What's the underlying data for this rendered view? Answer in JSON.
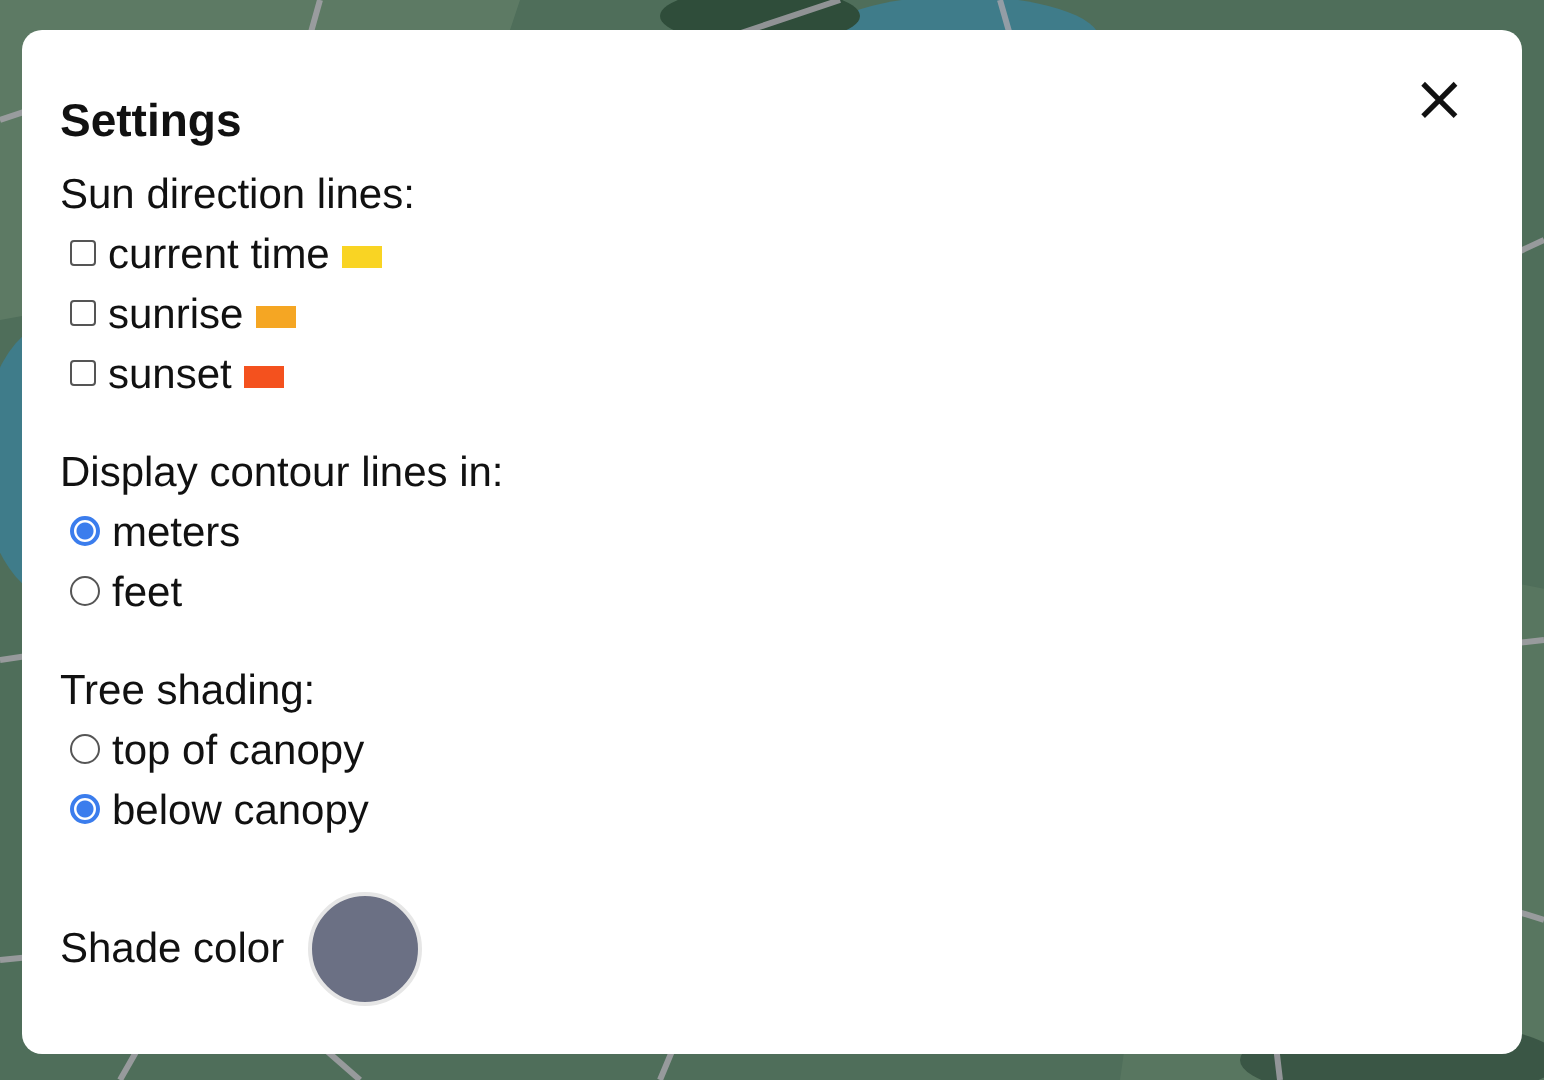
{
  "dialog": {
    "title": "Settings",
    "close": "×"
  },
  "sun_lines": {
    "label": "Sun direction lines:",
    "options": [
      {
        "label": "current time",
        "checked": false,
        "color": "#f9d423"
      },
      {
        "label": "sunrise",
        "checked": false,
        "color": "#f5a623"
      },
      {
        "label": "sunset",
        "checked": false,
        "color": "#f4511e"
      }
    ]
  },
  "contour_units": {
    "label": "Display contour lines in:",
    "options": [
      {
        "label": "meters",
        "selected": true
      },
      {
        "label": "feet",
        "selected": false
      }
    ]
  },
  "tree_shading": {
    "label": "Tree shading:",
    "options": [
      {
        "label": "top of canopy",
        "selected": false
      },
      {
        "label": "below canopy",
        "selected": true
      }
    ]
  },
  "shade_color": {
    "label": "Shade color",
    "color": "#6b7084"
  }
}
